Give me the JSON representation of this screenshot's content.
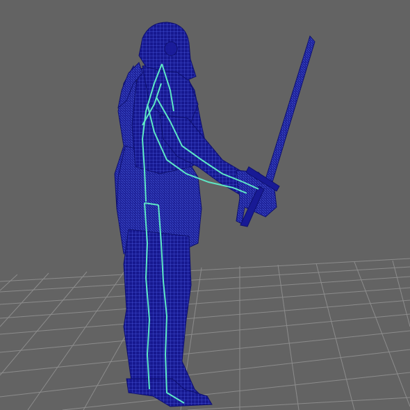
{
  "viewport": {
    "background": "#636363",
    "grid_color": "#8a8a8a",
    "mesh_fill": "#14168a",
    "wire_color": "#3b4bd6",
    "rig_color": "#5de6c4",
    "grid_floor": true,
    "selected_object": "knight-wireframe-mesh",
    "rig_visible": true
  }
}
